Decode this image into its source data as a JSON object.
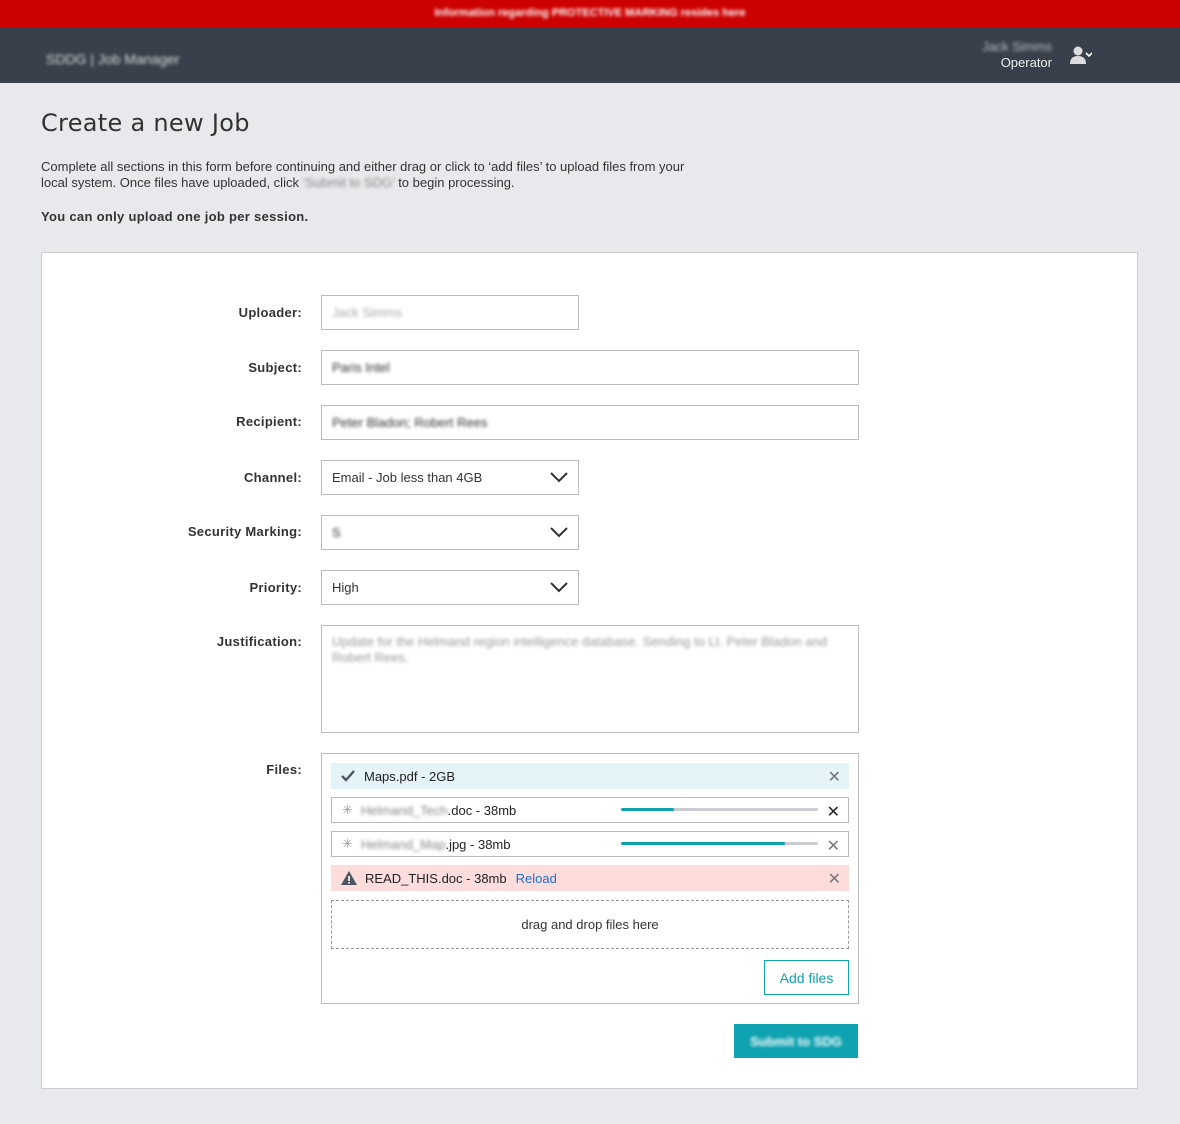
{
  "banner": {
    "text": "Information regarding PROTECTIVE MARKING resides here",
    "color": "#cc0000"
  },
  "header": {
    "brand": "SDDG | Job Manager",
    "user_name": "Jack Simms",
    "user_role": "Operator"
  },
  "page": {
    "title": "Create a new Job",
    "intro_1": "Complete all sections in this form before continuing and either drag or click to ‘add files’ to upload files from your local system. Once files have uploaded, click ",
    "intro_submit_ref": "‘Submit to SDG’",
    "intro_2": " to begin processing.",
    "note": "You can only upload one job per session."
  },
  "form": {
    "uploader": {
      "label": "Uploader:",
      "value": "Jack Simms"
    },
    "subject": {
      "label": "Subject:",
      "value": "Paris Intel"
    },
    "recipient": {
      "label": "Recipient:",
      "value": "Peter Bladon; Robert Rees"
    },
    "channel": {
      "label": "Channel:",
      "value": "Email - Job less than 4GB"
    },
    "security": {
      "label": "Security Marking:",
      "value": "S"
    },
    "priority": {
      "label": "Priority:",
      "value": "High"
    },
    "justification": {
      "label": "Justification:",
      "value": "Update for the Helmand region intelligence database. Sending to Lt. Peter Bladon and Robert Rees."
    },
    "files": {
      "label": "Files:",
      "items": [
        {
          "name": "Maps.pdf - 2GB",
          "status": "complete"
        },
        {
          "name_blurred": "Helmand_Tech",
          "name": ".doc - 38mb",
          "status": "uploading",
          "progress": 0.27
        },
        {
          "name_blurred": "Helmand_Map",
          "name": ".jpg - 38mb",
          "status": "uploading",
          "progress": 0.83
        },
        {
          "name": "READ_THIS.doc - 38mb",
          "status": "error",
          "action": "Reload"
        }
      ],
      "drop_text": "drag and drop files here",
      "add_label": "Add files"
    },
    "submit_label": "Submit to SDG"
  },
  "colors": {
    "accent": "#0fa2b0",
    "success_bg": "#e3f3f7",
    "error_bg": "#fddcdc",
    "link": "#1a6fd1"
  }
}
